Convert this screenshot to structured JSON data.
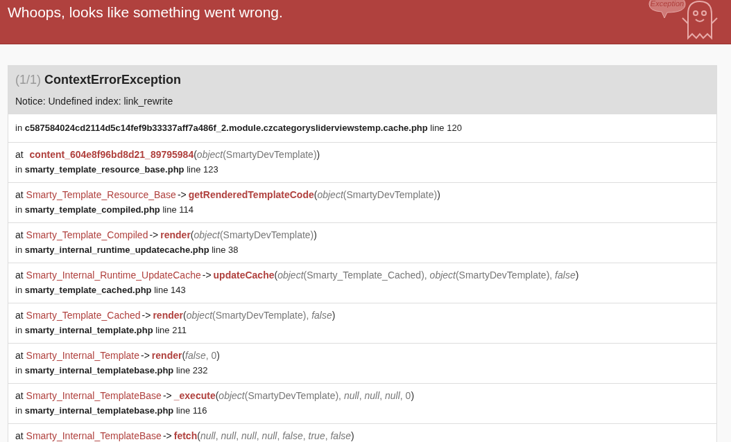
{
  "header": {
    "title": "Whoops, looks like something went wrong.",
    "logo_text": "Exception"
  },
  "exception": {
    "count": "(1/1)",
    "class": "ContextErrorException",
    "message": "Notice: Undefined index: link_rewrite",
    "location": "in **c587584024cd2114d5c14fef9b33337aff7a486f_2.module.czcategorysliderviewstemp.cache.php** line 120"
  },
  "trace": [
    {
      "at": "at",
      "function": "content_604e8f96bd8d21_89795984",
      "open": "(",
      "args": "*object*(SmartyDevTemplate)",
      "close": ")",
      "location": "in **smarty_template_resource_base.php** line 123"
    },
    {
      "at": "at",
      "class": "Smarty_Template_Resource_Base",
      "arrow": "->",
      "function": "getRenderedTemplateCode",
      "open": "(",
      "args": "*object*(SmartyDevTemplate)",
      "close": ")",
      "location": "in **smarty_template_compiled.php** line 114"
    },
    {
      "at": "at",
      "class": "Smarty_Template_Compiled",
      "arrow": "->",
      "function": "render",
      "open": "(",
      "args": "*object*(SmartyDevTemplate)",
      "close": ")",
      "location": "in **smarty_internal_runtime_updatecache.php** line 38"
    },
    {
      "at": "at",
      "class": "Smarty_Internal_Runtime_UpdateCache",
      "arrow": "->",
      "function": "updateCache",
      "open": "(",
      "args": "*object*(Smarty_Template_Cached), *object*(SmartyDevTemplate), *false*",
      "close": ")",
      "location": "in **smarty_template_cached.php** line 143"
    },
    {
      "at": "at",
      "class": "Smarty_Template_Cached",
      "arrow": "->",
      "function": "render",
      "open": "(",
      "args": "*object*(SmartyDevTemplate), *false*",
      "close": ")",
      "location": "in **smarty_internal_template.php** line 211"
    },
    {
      "at": "at",
      "class": "Smarty_Internal_Template",
      "arrow": "->",
      "function": "render",
      "open": "(",
      "args": "*false*, 0",
      "close": ")",
      "location": "in **smarty_internal_templatebase.php** line 232"
    },
    {
      "at": "at",
      "class": "Smarty_Internal_TemplateBase",
      "arrow": "->",
      "function": "_execute",
      "open": "(",
      "args": "*object*(SmartyDevTemplate), *null*, *null*, *null*, 0",
      "close": ")",
      "location": "in **smarty_internal_templatebase.php** line 116"
    },
    {
      "at": "at",
      "class": "Smarty_Internal_TemplateBase",
      "arrow": "->",
      "function": "fetch",
      "open": "(",
      "args": "*null*, *null*, *null*, *null*, *false*, *true*, *false*",
      "close": ")"
    }
  ]
}
